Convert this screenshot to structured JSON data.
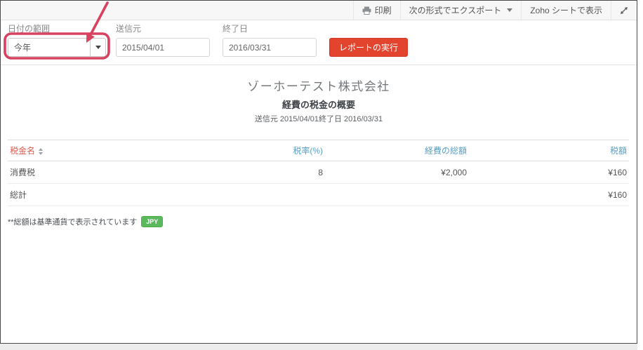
{
  "toolbar": {
    "print_label": "印刷",
    "export_label": "次の形式でエクスポート",
    "zoho_sheet_label": "Zoho シートで表示"
  },
  "filters": {
    "date_range": {
      "label": "日付の範囲",
      "value": "今年"
    },
    "start_date": {
      "label": "送信元",
      "value": "2015/04/01"
    },
    "end_date": {
      "label": "終了日",
      "value": "2016/03/31"
    },
    "run_button_label": "レポートの実行"
  },
  "report_header": {
    "company": "ゾーホーテスト株式会社",
    "title": "経費の税金の概要",
    "period": "送信元 2015/04/01終了日 2016/03/31"
  },
  "table": {
    "columns": [
      "税金名",
      "税率(%)",
      "経費の総額",
      "税額"
    ],
    "rows": [
      {
        "tax_name": "消費税",
        "tax_rate": "8",
        "expense_total": "¥2,000",
        "tax_amount": "¥160"
      },
      {
        "tax_name": "総計",
        "tax_rate": "",
        "expense_total": "",
        "tax_amount": "¥160"
      }
    ]
  },
  "footnote": {
    "text": "**総額は基準通貨で表示されています",
    "currency_badge": "JPY"
  },
  "icons": {
    "printer": "printer glyph",
    "caret_down": "▼",
    "expand": "diagonal double arrow",
    "sort": "▲▼"
  },
  "colors": {
    "run_button": "#e2442e",
    "link_blue": "#5a9fc0",
    "tax_name_red": "#e05a4b",
    "annotation_red": "#d8415f",
    "badge_green": "#5cb85c",
    "toolbar_bg": "#f7f7f7"
  }
}
